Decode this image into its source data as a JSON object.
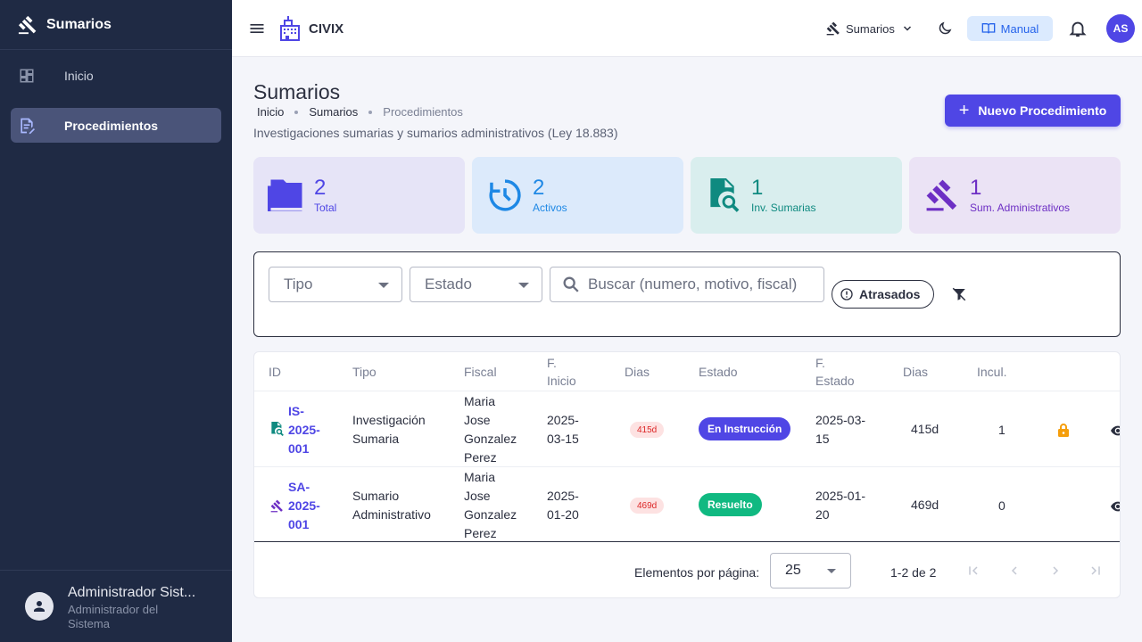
{
  "sidebar": {
    "title": "Sumarios",
    "items": [
      {
        "label": "Inicio",
        "icon": "dashboard-icon"
      },
      {
        "label": "Procedimientos",
        "icon": "document-edit-icon",
        "active": true
      }
    ],
    "user": {
      "name": "Administrador Sist...",
      "role": "Administrador del Sistema"
    }
  },
  "topbar": {
    "brand": "CIVIX",
    "module": "Sumarios",
    "manual": "Manual",
    "avatar": "AS"
  },
  "page": {
    "title": "Sumarios",
    "breadcrumb": [
      "Inicio",
      "Sumarios",
      "Procedimientos"
    ],
    "subtitle": "Investigaciones sumarias y sumarios administrativos (Ley 18.883)",
    "new_button": "Nuevo Procedimiento"
  },
  "stats": [
    {
      "value": "2",
      "label": "Total",
      "bg": "#e6e4f7",
      "color": "#4f46e5",
      "icon": "folder-icon"
    },
    {
      "value": "2",
      "label": "Activos",
      "bg": "#dceafb",
      "color": "#1e88e5",
      "icon": "history-icon"
    },
    {
      "value": "1",
      "label": "Inv. Sumarias",
      "bg": "#d9eeee",
      "color": "#0f8a80",
      "icon": "document-search-icon"
    },
    {
      "value": "1",
      "label": "Sum. Administrativos",
      "bg": "#ebe3f5",
      "color": "#6d2fc4",
      "icon": "gavel-icon"
    }
  ],
  "filters": {
    "tipo": "Tipo",
    "estado": "Estado",
    "search_placeholder": "Buscar (numero, motivo, fiscal)",
    "late_chip": "Atrasados"
  },
  "table": {
    "headers": [
      "ID",
      "Tipo",
      "Fiscal",
      "F. Inicio",
      "Dias",
      "Estado",
      "F. Estado",
      "Dias",
      "Incul."
    ],
    "rows": [
      {
        "id": [
          "IS-",
          "2025-",
          "001"
        ],
        "tipo": [
          "Investigación",
          "Sumaria"
        ],
        "fiscal": [
          "Maria",
          "Jose",
          "Gonzalez",
          "Perez"
        ],
        "inicio": [
          "2025-",
          "03-15"
        ],
        "dias": "415d",
        "estado": "En Instrucción",
        "estado_color": "#4f46e5",
        "f_estado": [
          "2025-03-",
          "15"
        ],
        "dias_estado": "415d",
        "inculpados": "1",
        "locked": true,
        "icon": "document-search-icon"
      },
      {
        "id": [
          "SA-",
          "2025-",
          "001"
        ],
        "tipo": [
          "Sumario",
          "Administrativo"
        ],
        "fiscal": [
          "Maria",
          "Jose",
          "Gonzalez",
          "Perez"
        ],
        "inicio": [
          "2025-",
          "01-20"
        ],
        "dias": "469d",
        "estado": "Resuelto",
        "estado_color": "#10b981",
        "f_estado": [
          "2025-01-",
          "20"
        ],
        "dias_estado": "469d",
        "inculpados": "0",
        "locked": false,
        "icon": "gavel-icon"
      }
    ]
  },
  "pagination": {
    "label": "Elementos por página:",
    "page_size": "25",
    "range": "1-2 de 2"
  }
}
